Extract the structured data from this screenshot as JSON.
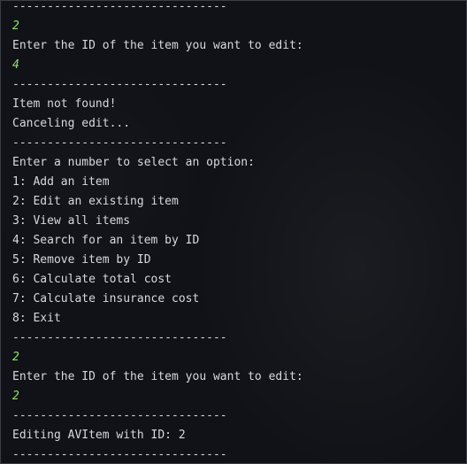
{
  "colors": {
    "background": "#101217",
    "output_text": "#d8d9dc",
    "user_input": "#8ee06a",
    "border": "#3a3d44"
  },
  "terminal": {
    "lines": [
      {
        "kind": "output",
        "text": "-------------------------------"
      },
      {
        "kind": "input",
        "text": "2"
      },
      {
        "kind": "output",
        "text": "Enter the ID of the item you want to edit:"
      },
      {
        "kind": "input",
        "text": "4"
      },
      {
        "kind": "output",
        "text": "-------------------------------"
      },
      {
        "kind": "output",
        "text": "Item not found!"
      },
      {
        "kind": "output",
        "text": "Canceling edit..."
      },
      {
        "kind": "output",
        "text": "-------------------------------"
      },
      {
        "kind": "output",
        "text": "Enter a number to select an option:"
      },
      {
        "kind": "output",
        "text": "1: Add an item"
      },
      {
        "kind": "output",
        "text": "2: Edit an existing item"
      },
      {
        "kind": "output",
        "text": "3: View all items"
      },
      {
        "kind": "output",
        "text": "4: Search for an item by ID"
      },
      {
        "kind": "output",
        "text": "5: Remove item by ID"
      },
      {
        "kind": "output",
        "text": "6: Calculate total cost"
      },
      {
        "kind": "output",
        "text": "7: Calculate insurance cost"
      },
      {
        "kind": "output",
        "text": "8: Exit"
      },
      {
        "kind": "output",
        "text": "-------------------------------"
      },
      {
        "kind": "input",
        "text": "2"
      },
      {
        "kind": "output",
        "text": "Enter the ID of the item you want to edit:"
      },
      {
        "kind": "input",
        "text": "2"
      },
      {
        "kind": "output",
        "text": "-------------------------------"
      },
      {
        "kind": "output",
        "text": "Editing AVItem with ID: 2"
      },
      {
        "kind": "output",
        "text": "-------------------------------"
      }
    ]
  }
}
